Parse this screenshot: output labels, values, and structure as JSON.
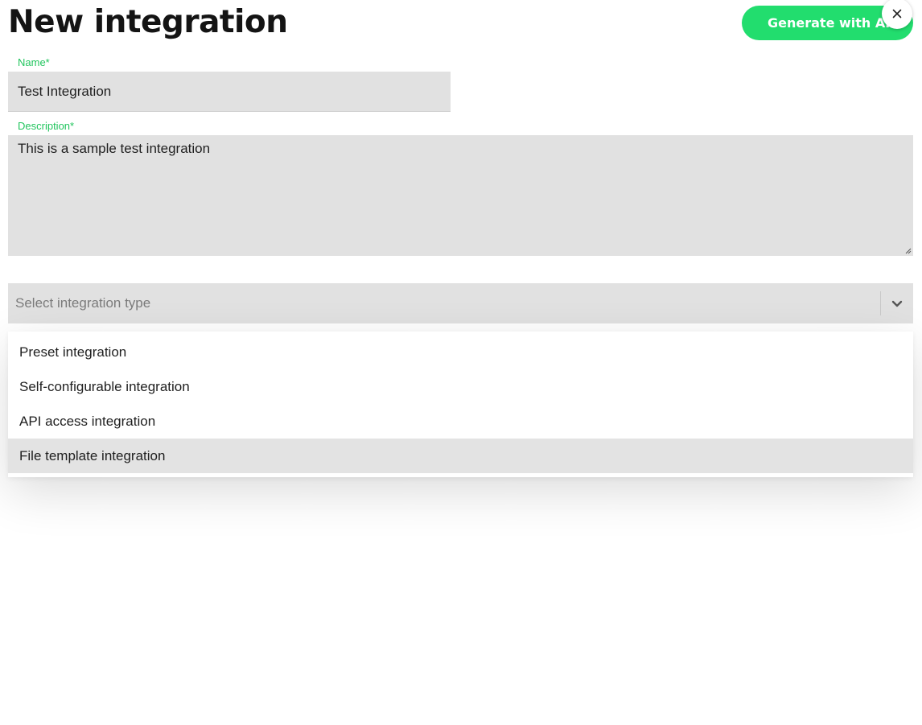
{
  "header": {
    "title": "New integration",
    "generate_button_label": "Generate with AI",
    "close_icon": "close-icon"
  },
  "form": {
    "name": {
      "label": "Name*",
      "value": "Test Integration"
    },
    "description": {
      "label": "Description*",
      "value": "This is a sample test integration"
    },
    "integration_type": {
      "placeholder": "Select integration type",
      "icon": "chevron-down-icon",
      "options": [
        {
          "label": "Preset integration"
        },
        {
          "label": "Self-configurable integration"
        },
        {
          "label": "API access integration"
        },
        {
          "label": "File template integration"
        }
      ],
      "highlighted_option": "File template integration"
    }
  },
  "colors": {
    "accent": "#22dd6e",
    "label_green": "#22c55e",
    "field_background": "#e1e1e1"
  }
}
